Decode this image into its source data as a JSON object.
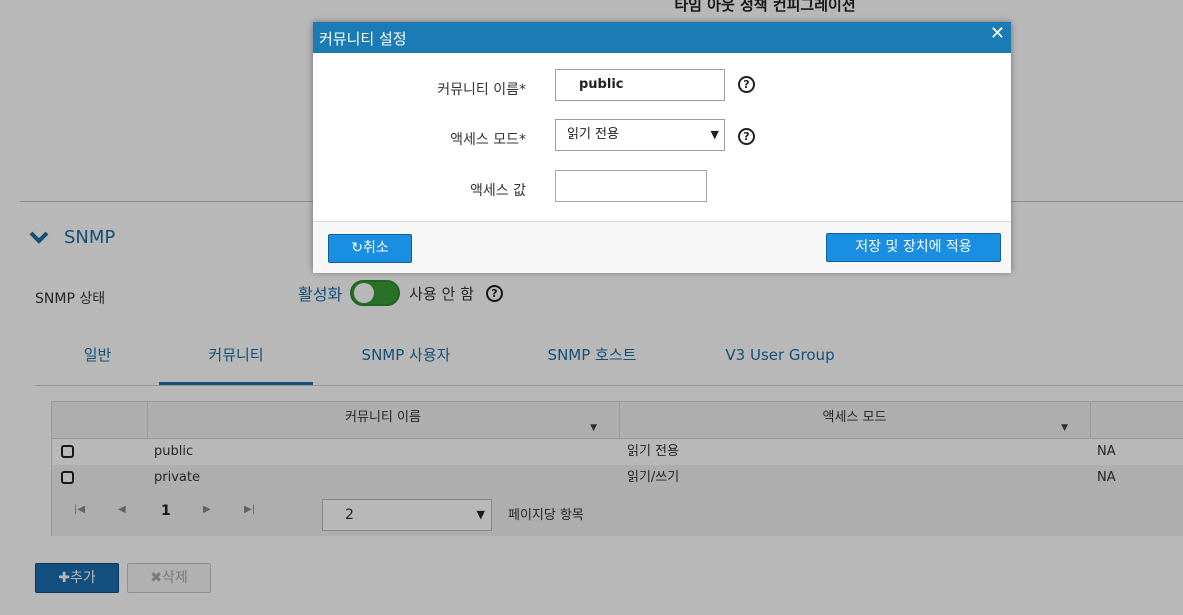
{
  "background": {
    "top_title": "타임 아웃 정책 컨피그레이션",
    "section": {
      "title": "SNMP",
      "icon": "chevron-down-icon"
    },
    "snmp_status": {
      "label": "SNMP 상태",
      "on_label": "활성화",
      "off_label": "사용 안 함"
    },
    "tabs": [
      {
        "label": "일반"
      },
      {
        "label": "커뮤니티",
        "active": true
      },
      {
        "label": "SNMP 사용자"
      },
      {
        "label": "SNMP 호스트"
      },
      {
        "label": "V3 User Group"
      }
    ],
    "grid": {
      "columns": [
        "커뮤니티 이름",
        "액세스 모드"
      ],
      "rows": [
        {
          "name": "public",
          "mode": "읽기 전용",
          "extra": "NA"
        },
        {
          "name": "private",
          "mode": "읽기/쓰기",
          "extra": "NA"
        }
      ],
      "pager": {
        "page": "1",
        "page_size": "2",
        "page_size_label": "페이지당 항목"
      }
    },
    "buttons": {
      "add": "✚추가",
      "delete": "✖삭제"
    }
  },
  "dialog": {
    "title": "커뮤니티 설정",
    "close_glyph": "✕",
    "fields": {
      "community_name": {
        "label": "커뮤니티 이름*",
        "value": "public"
      },
      "access_mode": {
        "label": "액세스 모드*",
        "value": "읽기 전용"
      },
      "access_value": {
        "label": "액세스 값",
        "value": ""
      }
    },
    "buttons": {
      "cancel": "↻취소",
      "save": "저장 및 장치에 적용"
    }
  },
  "colors": {
    "accent": "#1b7bb5",
    "toggle_on": "#3a9b3a",
    "button": "#1a8ee0"
  }
}
